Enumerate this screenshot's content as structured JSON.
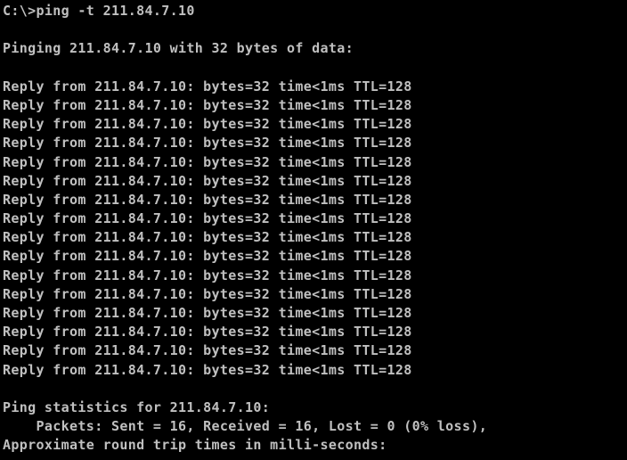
{
  "console": {
    "text_color": "#c0c0c0",
    "background_color": "#000000",
    "lines": [
      "C:\\>ping -t 211.84.7.10",
      "",
      "Pinging 211.84.7.10 with 32 bytes of data:",
      "",
      "Reply from 211.84.7.10: bytes=32 time<1ms TTL=128",
      "Reply from 211.84.7.10: bytes=32 time<1ms TTL=128",
      "Reply from 211.84.7.10: bytes=32 time<1ms TTL=128",
      "Reply from 211.84.7.10: bytes=32 time<1ms TTL=128",
      "Reply from 211.84.7.10: bytes=32 time<1ms TTL=128",
      "Reply from 211.84.7.10: bytes=32 time<1ms TTL=128",
      "Reply from 211.84.7.10: bytes=32 time<1ms TTL=128",
      "Reply from 211.84.7.10: bytes=32 time<1ms TTL=128",
      "Reply from 211.84.7.10: bytes=32 time<1ms TTL=128",
      "Reply from 211.84.7.10: bytes=32 time<1ms TTL=128",
      "Reply from 211.84.7.10: bytes=32 time<1ms TTL=128",
      "Reply from 211.84.7.10: bytes=32 time<1ms TTL=128",
      "Reply from 211.84.7.10: bytes=32 time<1ms TTL=128",
      "Reply from 211.84.7.10: bytes=32 time<1ms TTL=128",
      "Reply from 211.84.7.10: bytes=32 time<1ms TTL=128",
      "Reply from 211.84.7.10: bytes=32 time<1ms TTL=128",
      "",
      "Ping statistics for 211.84.7.10:",
      "    Packets: Sent = 16, Received = 16, Lost = 0 (0% loss),",
      "Approximate round trip times in milli-seconds:"
    ]
  }
}
